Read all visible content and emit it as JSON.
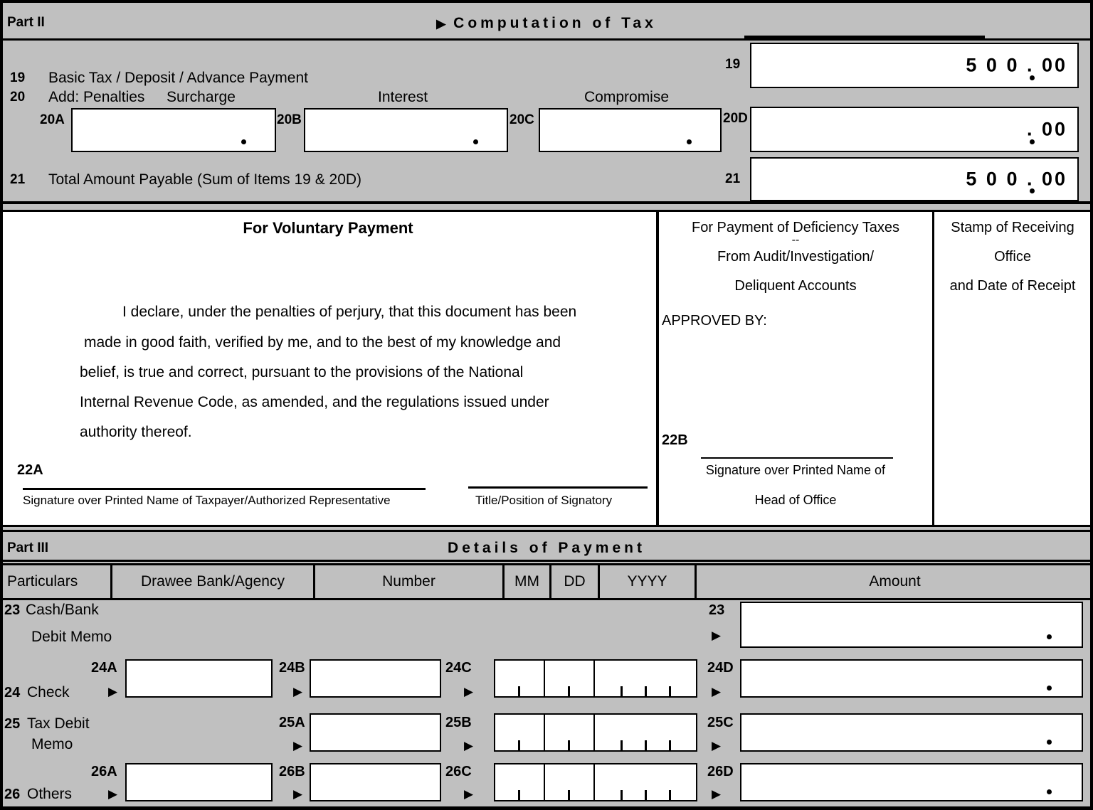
{
  "colors": {
    "panel_gray": "#c0c0c0",
    "field_white": "#ffffff",
    "ink": "#000000"
  },
  "part2": {
    "part_label": "Part II",
    "title": "Computation of Tax",
    "arrow_icon": "▶",
    "line19": {
      "number": "19",
      "label": "Basic Tax / Deposit / Advance Payment",
      "box_number": "19",
      "value": "5 0 0 . 00"
    },
    "line20": {
      "number": "20",
      "label": "Add: Penalties",
      "col_surcharge": "Surcharge",
      "col_interest": "Interest",
      "col_compromise": "Compromise",
      "tag_a": "20A",
      "tag_b": "20B",
      "tag_c": "20C",
      "tag_d": "20D",
      "value_a": "",
      "value_b": "",
      "value_c": "",
      "value_d": ". 00"
    },
    "line21": {
      "number": "21",
      "label": "Total Amount Payable  (Sum of Items 19 & 20D)",
      "box_number": "21",
      "value": "5 0 0 . 00"
    }
  },
  "voluntary": {
    "heading": "For Voluntary Payment",
    "declaration": [
      "I declare, under the penalties of perjury, that this document has been",
      "made in good faith, verified by me, and to the  best of my knowledge and",
      "belief, is true  and correct, pursuant  to the  provisions of the  National",
      "Internal Revenue Code, as amended, and the regulations issued under",
      "authority thereof."
    ],
    "tag_22a": "22A",
    "sig_caption": "Signature over Printed Name of Taxpayer/Authorized Representative",
    "title_caption": "Title/Position of Signatory"
  },
  "deficiency": {
    "heading_line1": "For Payment of Deficiency Taxes",
    "heading_line2": "--",
    "heading_line3": "From Audit/Investigation/",
    "heading_line4": "Deliquent Accounts",
    "approved_by": "APPROVED BY:",
    "tag_22b": "22B",
    "sig_caption_line1": "Signature over Printed Name of",
    "sig_caption_line2": "Head of Office"
  },
  "stamp": {
    "line1": "Stamp of Receiving",
    "line2": "Office",
    "line3": "and Date of Receipt"
  },
  "part3": {
    "part_label": "Part III",
    "title": "Details of Payment",
    "columns": [
      "Particulars",
      "Drawee Bank/Agency",
      "Number",
      "MM",
      "DD",
      "YYYY",
      "Amount"
    ],
    "rows": [
      {
        "number": "23",
        "label_line1": "Cash/Bank",
        "label_line2": "Debit Memo",
        "bank_tag": "",
        "bank_value": "",
        "number_tag": "",
        "number_value": "",
        "date_tag": "",
        "date_mm": "",
        "date_dd": "",
        "date_yyyy": "",
        "amount_tag": "23",
        "amount_value": ""
      },
      {
        "number": "24",
        "label_line1": "Check",
        "label_line2": "",
        "bank_tag": "24A",
        "bank_value": "",
        "number_tag": "24B",
        "number_value": "",
        "date_tag": "24C",
        "date_mm": "",
        "date_dd": "",
        "date_yyyy": "",
        "amount_tag": "24D",
        "amount_value": ""
      },
      {
        "number": "25",
        "label_line1": "Tax Debit",
        "label_line2": "Memo",
        "bank_tag": "",
        "bank_value": "",
        "number_tag": "25A",
        "number_value": "",
        "date_tag": "25B",
        "date_mm": "",
        "date_dd": "",
        "date_yyyy": "",
        "amount_tag": "25C",
        "amount_value": ""
      },
      {
        "number": "26",
        "label_line1": "Others",
        "label_line2": "",
        "bank_tag": "26A",
        "bank_value": "",
        "number_tag": "26B",
        "number_value": "",
        "date_tag": "26C",
        "date_mm": "",
        "date_dd": "",
        "date_yyyy": "",
        "amount_tag": "26D",
        "amount_value": ""
      }
    ],
    "row_arrow_icon": "▶"
  }
}
